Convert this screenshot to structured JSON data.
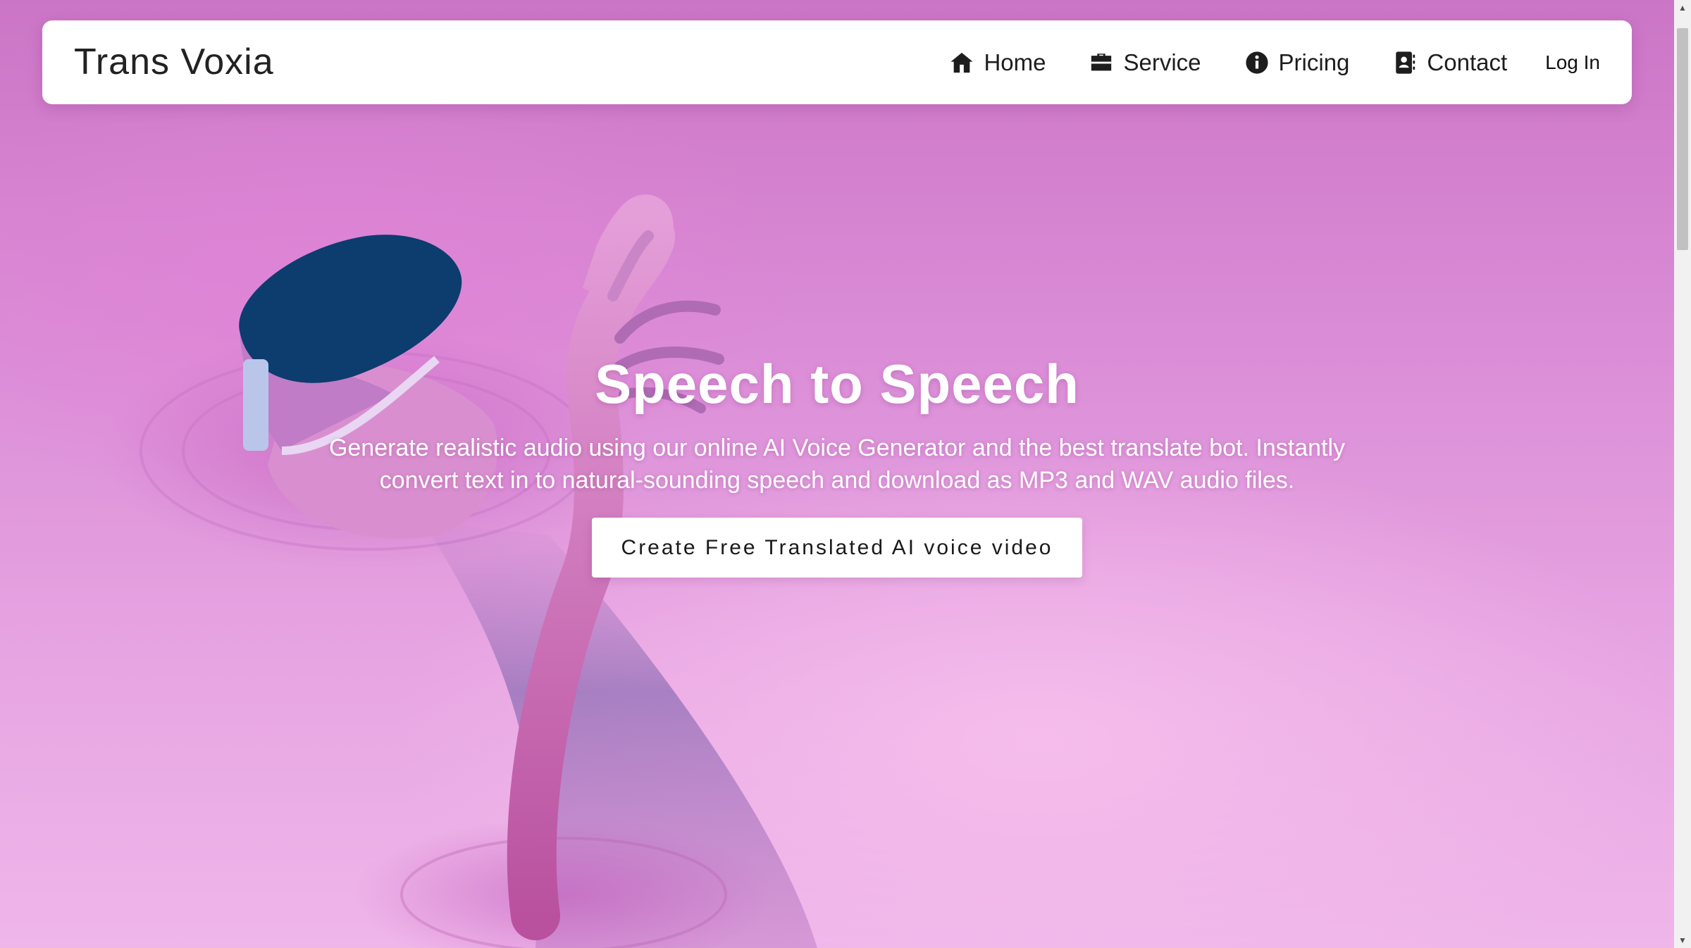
{
  "navbar": {
    "brand": "Trans Voxia",
    "links": [
      {
        "label": "Home",
        "icon": "home-icon"
      },
      {
        "label": "Service",
        "icon": "briefcase-icon"
      },
      {
        "label": "Pricing",
        "icon": "info-circle-icon"
      },
      {
        "label": "Contact",
        "icon": "contact-card-icon"
      }
    ],
    "login": "Log In"
  },
  "hero": {
    "title": "Speech to Speech",
    "description": "Generate realistic audio using our online AI Voice Generator and the best translate bot. Instantly convert text in to natural-sounding speech and download as MP3 and WAV audio files.",
    "cta": "Create Free Translated AI voice video"
  },
  "theme": {
    "background": "#da8cd6",
    "navbar_bg": "#ffffff",
    "headset": "#0d3c6e"
  }
}
